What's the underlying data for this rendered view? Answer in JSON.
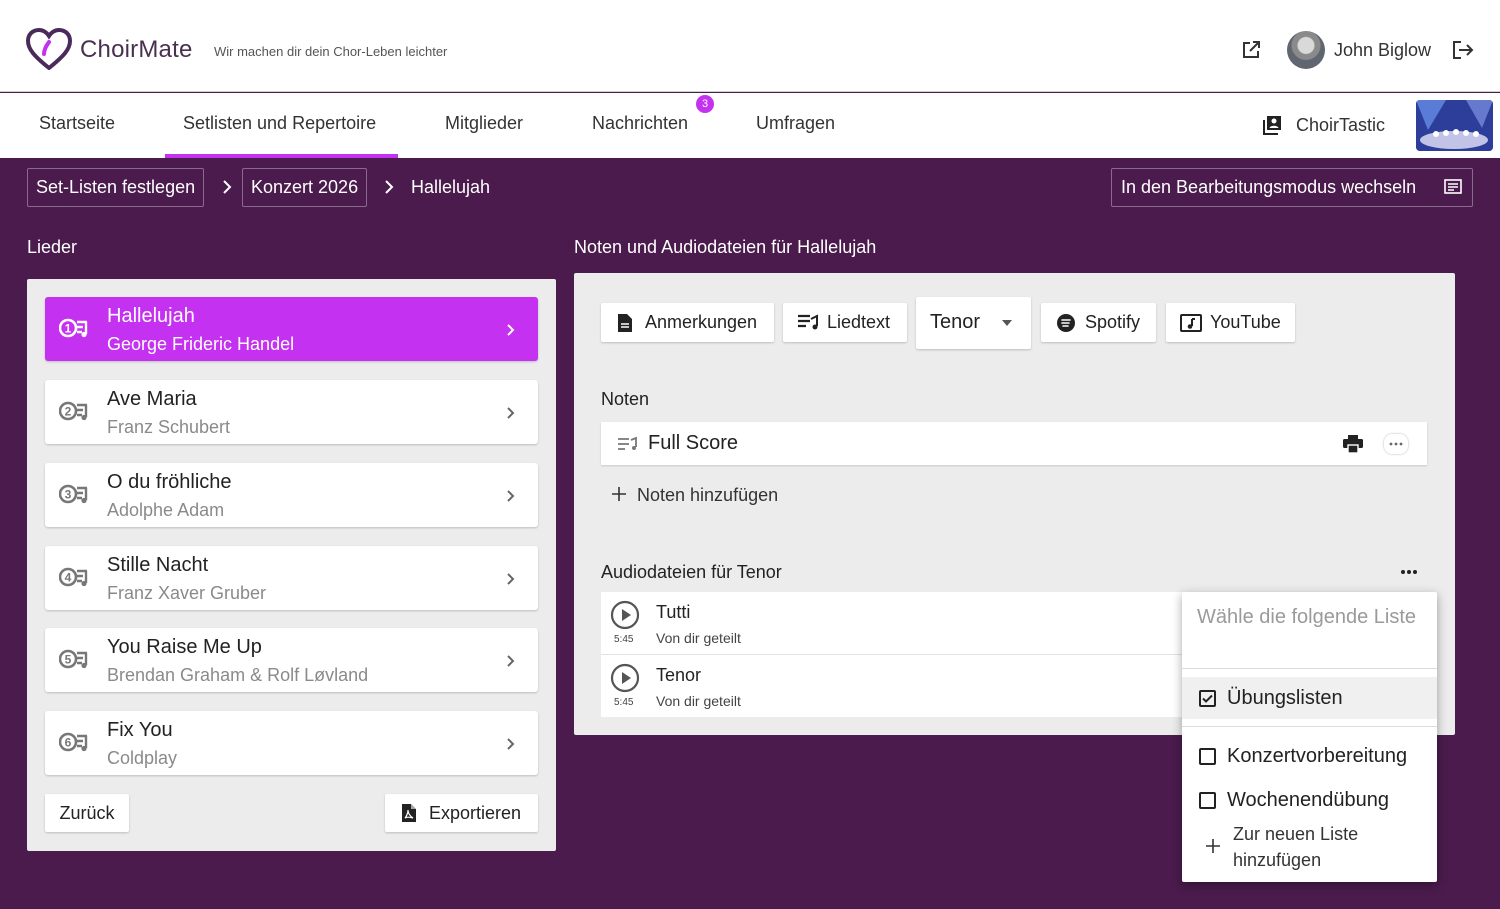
{
  "header": {
    "app_name": "ChoirMate",
    "tagline": "Wir machen dir dein Chor-Leben leichter",
    "user_name": "John Biglow"
  },
  "nav": {
    "items": [
      {
        "label": "Startseite"
      },
      {
        "label": "Setlisten und Repertoire",
        "active": true
      },
      {
        "label": "Mitglieder"
      },
      {
        "label": "Nachrichten",
        "badge": "3"
      },
      {
        "label": "Umfragen"
      }
    ],
    "choir_name": "ChoirTastic"
  },
  "breadcrumb": {
    "items": [
      "Set-Listen festlegen",
      "Konzert 2026"
    ],
    "current": "Hallelujah"
  },
  "edit_mode_label": "In den Bearbeitungsmodus wechseln",
  "songs_panel": {
    "title": "Lieder",
    "songs": [
      {
        "number": "1",
        "title": "Hallelujah",
        "composer": "George Frideric Handel",
        "active": true
      },
      {
        "number": "2",
        "title": "Ave Maria",
        "composer": "Franz Schubert"
      },
      {
        "number": "3",
        "title": "O du fröhliche",
        "composer": "Adolphe Adam"
      },
      {
        "number": "4",
        "title": "Stille Nacht",
        "composer": "Franz Xaver Gruber"
      },
      {
        "number": "5",
        "title": "You Raise Me Up",
        "composer": "Brendan Graham & Rolf Løvland"
      },
      {
        "number": "6",
        "title": "Fix You",
        "composer": "Coldplay"
      }
    ],
    "back_label": "Zurück",
    "export_label": "Exportieren"
  },
  "detail": {
    "title": "Noten und Audiodateien für Hallelujah",
    "toolbar": {
      "notes_label": "Anmerkungen",
      "lyrics_label": "Liedtext",
      "voice_selected": "Tenor",
      "spotify_label": "Spotify",
      "youtube_label": "YouTube"
    },
    "scores_title": "Noten",
    "scores": [
      {
        "name": "Full Score"
      }
    ],
    "add_score_label": "Noten hinzufügen",
    "audio_title": "Audiodateien für Tenor",
    "audio": [
      {
        "title": "Tutti",
        "duration": "5:45",
        "shared": "Von dir geteilt"
      },
      {
        "title": "Tenor",
        "duration": "5:45",
        "shared": "Von dir geteilt"
      }
    ]
  },
  "menu": {
    "header": "Wähle die folgende Liste",
    "items": [
      {
        "label": "Übungslisten",
        "checked": true
      },
      {
        "label": "Konzertvorbereitung",
        "checked": false
      },
      {
        "label": "Wochenendübung",
        "checked": false
      }
    ],
    "add_label": "Zur neuen Liste hinzufügen"
  },
  "colors": {
    "accent": "#c431f0",
    "background": "#4a1b4c",
    "panel": "#ececec"
  }
}
